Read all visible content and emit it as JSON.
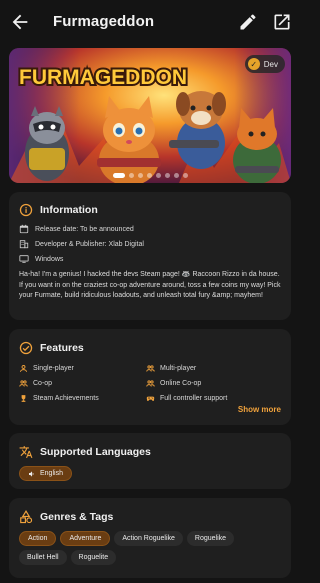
{
  "header": {
    "title": "Furmageddon"
  },
  "banner": {
    "logo_text": "FURMAGEDDON",
    "badge_label": "Dev",
    "carousel_count": 8,
    "carousel_active": 1
  },
  "information": {
    "heading": "Information",
    "release_date": "Release date: To be announced",
    "developer": "Developer & Publisher: Xlab Digital",
    "platform": "Windows",
    "description": "Ha-ha! I'm a genius! I hacked the devs Steam page! 🦝 Raccoon Rizzo in da house. If you want in on the craziest co-op adventure around, toss a few coins my way! Pick your Furmate, build ridiculous loadouts, and unleash total fury &amp; mayhem!"
  },
  "features": {
    "heading": "Features",
    "items": [
      {
        "label": "Single-player",
        "icon": "person-icon"
      },
      {
        "label": "Multi-player",
        "icon": "group-icon"
      },
      {
        "label": "Co-op",
        "icon": "group-icon"
      },
      {
        "label": "Online Co-op",
        "icon": "group-icon"
      },
      {
        "label": "Steam Achievements",
        "icon": "trophy-icon"
      },
      {
        "label": "Full controller support",
        "icon": "gamepad-icon"
      }
    ],
    "show_more": "Show more"
  },
  "languages": {
    "heading": "Supported Languages",
    "items": [
      "English"
    ]
  },
  "genres": {
    "heading": "Genres & Tags",
    "tags": [
      {
        "label": "Action",
        "highlight": true
      },
      {
        "label": "Adventure",
        "highlight": true
      },
      {
        "label": "Action Roguelike",
        "highlight": false
      },
      {
        "label": "Roguelike",
        "highlight": false
      },
      {
        "label": "Bullet Hell",
        "highlight": false
      },
      {
        "label": "Roguelite",
        "highlight": false
      }
    ]
  },
  "colors": {
    "accent": "#f0a23c",
    "background": "#141414",
    "card": "#1f1f1f",
    "chip_highlight": "#6a3d12",
    "chip_plain": "#2c2c2c"
  }
}
